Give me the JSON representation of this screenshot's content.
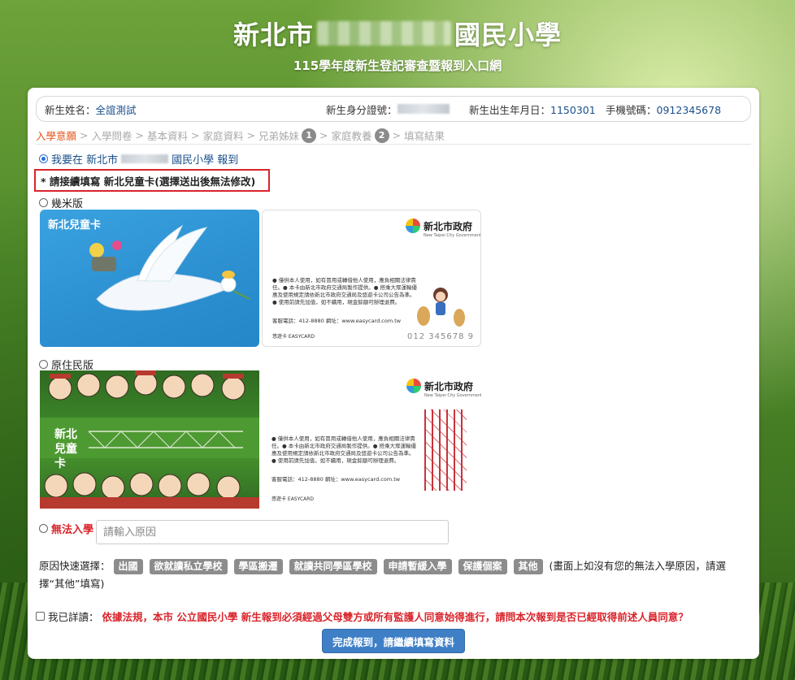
{
  "header": {
    "title_prefix": "新北市",
    "title_suffix": "國民小學",
    "subtitle": "115學年度新生登記審查暨報到入口網"
  },
  "student": {
    "name_label": "新生姓名：",
    "name_value": "全誼測試",
    "id_label": "新生身分證號：",
    "birth_label": "新生出生年月日：",
    "birth_value": "1150301",
    "phone_label": "手機號碼：",
    "phone_value": "0912345678"
  },
  "steps": {
    "s1": "入學意願",
    "s2": "入學問卷",
    "s3": "基本資料",
    "s4": "家庭資料",
    "s5": "兄弟姊妹",
    "s5_badge": "1",
    "s6": "家庭教養",
    "s6_badge": "2",
    "s7": "填寫結果",
    "sep": ">"
  },
  "enroll_option": {
    "text_prefix": "我要在 新北市",
    "text_suffix": "國民小學 報到"
  },
  "notice": "* 請接續填寫 新北兒童卡(選擇送出後無法修改)",
  "cards": {
    "option_a_label": "幾米版",
    "option_a_card_title": "新北兒童卡",
    "option_b_label": "原住民版",
    "option_b_card_title": "新北兒童卡",
    "gov_name": "新北市政府",
    "gov_en": "New Taipei City Government",
    "terms": "● 僅供本人使用，如有冒用或轉借他人使用，應負相關法律責任。● 本卡由新北市政府交通局製作提供。● 搭乘大眾運輸優惠及使用規定請依新北市政府交通局及悠遊卡公司公告為準。● 使用前請先加值，如不續用，現金餘額可辦理退費。",
    "service": "客服電話：412-8880 網址：www.easycard.com.tw",
    "easycard": "悠遊卡 EASYCARD",
    "card_number": "012 345678 9"
  },
  "refuse": {
    "label": "無法入學",
    "placeholder": "請輸入原因"
  },
  "quick_reasons": {
    "label": "原因快速選擇：",
    "tags": [
      "出國",
      "欲就讀私立學校",
      "學區搬遷",
      "就讀共同學區學校",
      "申請暫緩入學",
      "保護個案",
      "其他"
    ],
    "hint": "(畫面上如沒有您的無法入學原因，請選擇“其他”填寫)"
  },
  "agreement": {
    "label": "我已詳讀：",
    "note": "依據法規，本市 公立國民小學 新生報到必須經過父母雙方或所有監護人同意始得進行，請問本次報到是否已經取得前述人員同意？"
  },
  "submit_label": "完成報到，請繼續填寫資料",
  "colors": {
    "accent": "#3f7fc6",
    "alert": "#d9242b",
    "active_step": "#e2561d"
  }
}
